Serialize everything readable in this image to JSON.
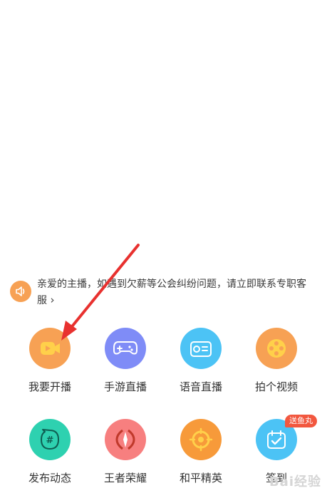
{
  "notice": {
    "text": "亲爱的主播，如遇到欠薪等公会纠纷问题，请立即联系专职客服",
    "chevron": "›",
    "icon": "speaker-icon",
    "color": "#f7a154"
  },
  "actions": [
    {
      "label": "我要开播",
      "icon": "video-camera-icon",
      "color": "#f7a154"
    },
    {
      "label": "手游直播",
      "icon": "gamepad-icon",
      "color": "#7f8cf7"
    },
    {
      "label": "语音直播",
      "icon": "radio-icon",
      "color": "#4cc3f5"
    },
    {
      "label": "拍个视频",
      "icon": "film-reel-icon",
      "color": "#f7a154"
    },
    {
      "label": "发布动态",
      "icon": "hashtag-bubble-icon",
      "color": "#2ed1b0"
    },
    {
      "label": "王者荣耀",
      "icon": "game-emblem-icon",
      "color": "#f77f7f"
    },
    {
      "label": "和平精英",
      "icon": "crosshair-icon",
      "color": "#f79a3a"
    },
    {
      "label": "签到",
      "icon": "calendar-check-icon",
      "color": "#4cc3f5",
      "badge": "送鱼丸"
    }
  ],
  "annotation": {
    "arrow_color": "#e8312f"
  },
  "watermark": "Bai经验"
}
